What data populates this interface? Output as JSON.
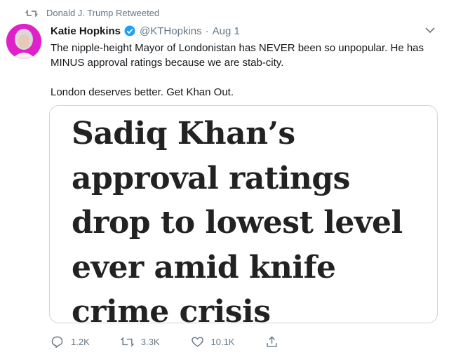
{
  "retweet_context": {
    "text": "Donald J. Trump Retweeted"
  },
  "author": {
    "display_name": "Katie Hopkins",
    "handle": "@KTHopkins",
    "separator": "·",
    "date": "Aug 1"
  },
  "tweet": {
    "paragraphs": [
      "The nipple-height Mayor of Londonistan has NEVER been so unpopular. He has MINUS approval ratings because we are stab-city.",
      "London deserves better. Get Khan Out."
    ]
  },
  "media": {
    "headline_lines": [
      "Sadiq Khan’s",
      "approval ratings",
      "drop to lowest level",
      "ever amid knife",
      "crime crisis"
    ]
  },
  "actions": {
    "reply_count": "1.2K",
    "retweet_count": "3.3K",
    "like_count": "10.1K"
  },
  "colors": {
    "verified": "#1da1f2",
    "muted": "#657786",
    "avatar_bg": "#e020c8",
    "border": "#ccd6dd"
  },
  "icons": [
    "retweet-icon",
    "verified-badge-icon",
    "chevron-down-icon",
    "reply-icon",
    "retweet-icon",
    "like-icon",
    "share-icon"
  ]
}
